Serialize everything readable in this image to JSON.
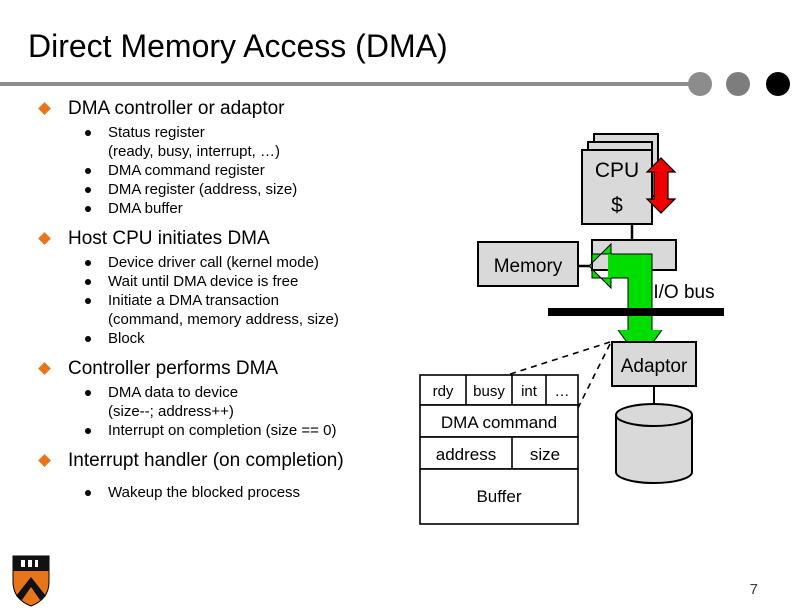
{
  "slide": {
    "title": "Direct Memory Access (DMA)",
    "page_number": "7",
    "logo_name": "princeton-shield-logo",
    "accent_bullet_color": "#E8751A",
    "rule_color": "#8c8c8c"
  },
  "bullets": [
    {
      "heading": "DMA controller or adaptor",
      "items": [
        {
          "text": "Status register",
          "cont": "(ready, busy, interrupt, …)"
        },
        {
          "text": "DMA command register",
          "cont": ""
        },
        {
          "text": "DMA register (address, size)",
          "cont": ""
        },
        {
          "text": "DMA buffer",
          "cont": ""
        }
      ]
    },
    {
      "heading": "Host CPU initiates DMA",
      "items": [
        {
          "text": "Device driver call (kernel mode)",
          "cont": ""
        },
        {
          "text": "Wait until DMA device is free",
          "cont": ""
        },
        {
          "text": "Initiate a DMA transaction",
          "cont": "(command, memory address, size)"
        },
        {
          "text": "Block",
          "cont": ""
        }
      ]
    },
    {
      "heading": "Controller performs DMA",
      "items": [
        {
          "text": "DMA data to device",
          "cont": "(size--; address++)"
        },
        {
          "text": "Interrupt on completion (size == 0)",
          "cont": ""
        }
      ]
    },
    {
      "heading": "Interrupt handler (on completion)",
      "items": [
        {
          "text": "Wakeup the blocked process",
          "cont": ""
        }
      ]
    }
  ],
  "diagram": {
    "cpu_label": "CPU",
    "cache_label": "$",
    "memory_label": "Memory",
    "bus_label": "I/O bus",
    "adaptor_label": "Adaptor",
    "disk_name": "disk-cylinder",
    "cpu_arrow_color": "#EE0000",
    "dma_arrow_color": "#00DD00",
    "box_fill": "#D9D9D9",
    "registers": {
      "status_cells": [
        "rdy",
        "busy",
        "int",
        "…"
      ],
      "command_row": "DMA command",
      "address_cell": "address",
      "size_cell": "size",
      "buffer_row": "Buffer"
    }
  }
}
